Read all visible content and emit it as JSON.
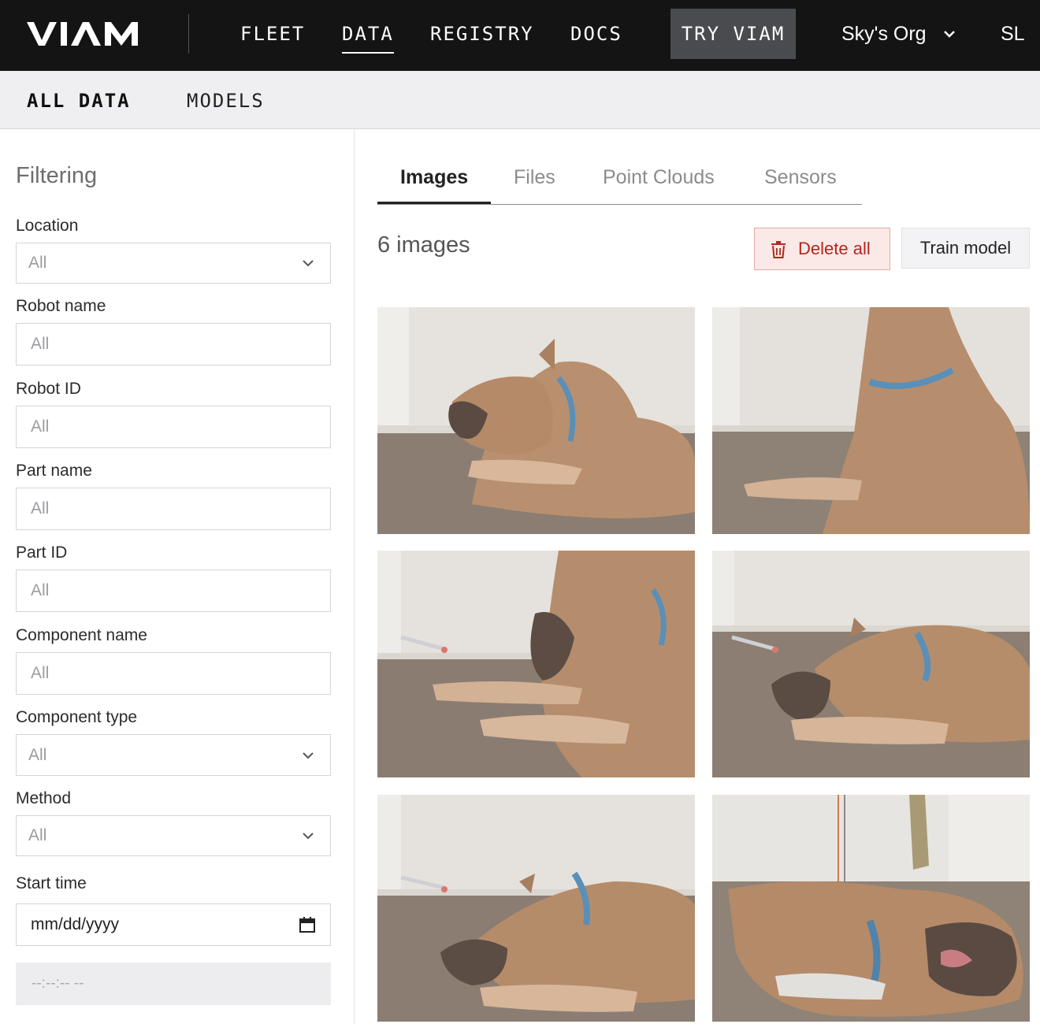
{
  "brand": {
    "logo_text": "VIAM"
  },
  "nav": {
    "items": [
      {
        "label": "FLEET"
      },
      {
        "label": "DATA"
      },
      {
        "label": "REGISTRY"
      },
      {
        "label": "DOCS"
      }
    ],
    "active": "DATA",
    "try_button": "TRY VIAM",
    "org_name": "Sky's Org",
    "avatar_initials": "SL"
  },
  "subnav": {
    "items": [
      {
        "label": "ALL DATA"
      },
      {
        "label": "MODELS"
      }
    ],
    "active": "ALL DATA"
  },
  "filters": {
    "title": "Filtering",
    "location": {
      "label": "Location",
      "value": "All"
    },
    "robot_name": {
      "label": "Robot name",
      "placeholder": "All"
    },
    "robot_id": {
      "label": "Robot ID",
      "placeholder": "All"
    },
    "part_name": {
      "label": "Part name",
      "placeholder": "All"
    },
    "part_id": {
      "label": "Part ID",
      "placeholder": "All"
    },
    "component_name": {
      "label": "Component name",
      "placeholder": "All"
    },
    "component_type": {
      "label": "Component type",
      "value": "All"
    },
    "method": {
      "label": "Method",
      "value": "All"
    },
    "start_time": {
      "label": "Start time",
      "date_placeholder": "mm/dd/yyyy",
      "time_placeholder": "--:--:-- --"
    }
  },
  "main": {
    "tabs": [
      {
        "label": "Images"
      },
      {
        "label": "Files"
      },
      {
        "label": "Point Clouds"
      },
      {
        "label": "Sensors"
      }
    ],
    "active_tab": "Images",
    "count_label": "6 images",
    "delete_all_label": "Delete all",
    "train_model_label": "Train model"
  },
  "colors": {
    "topbar": "#141414",
    "try_button_bg": "#4a4b4f",
    "delete_bg": "#fbe9e7",
    "delete_text": "#b3261e"
  },
  "icons": {
    "chevron": "chevron-down-icon",
    "calendar": "calendar-icon",
    "trash": "trash-icon"
  }
}
